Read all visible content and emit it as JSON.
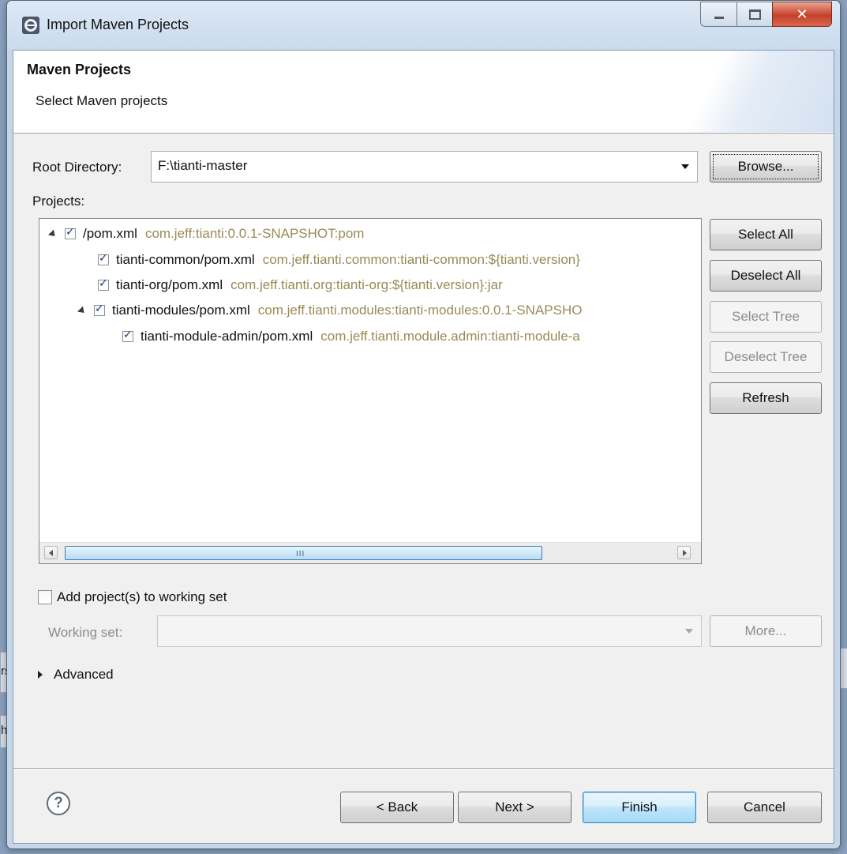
{
  "window": {
    "title": "Import Maven Projects"
  },
  "header": {
    "title": "Maven Projects",
    "subtitle": "Select Maven projects"
  },
  "root_directory": {
    "label": "Root Directory:",
    "value": "F:\\tianti-master",
    "browse": "Browse..."
  },
  "projects": {
    "label": "Projects:",
    "rows": [
      {
        "name": "/pom.xml",
        "coords": "com.jeff:tianti:0.0.1-SNAPSHOT:pom",
        "checked": true
      },
      {
        "name": "tianti-common/pom.xml",
        "coords": "com.jeff.tianti.common:tianti-common:${tianti.version}",
        "checked": true
      },
      {
        "name": "tianti-org/pom.xml",
        "coords": "com.jeff.tianti.org:tianti-org:${tianti.version}:jar",
        "checked": true
      },
      {
        "name": "tianti-modules/pom.xml",
        "coords": "com.jeff.tianti.modules:tianti-modules:0.0.1-SNAPSHO",
        "checked": true
      },
      {
        "name": "tianti-module-admin/pom.xml",
        "coords": "com.jeff.tianti.module.admin:tianti-module-a",
        "checked": true
      }
    ],
    "scroll_grip": "III"
  },
  "side_buttons": {
    "select_all": "Select All",
    "deselect_all": "Deselect All",
    "select_tree": "Select Tree",
    "deselect_tree": "Deselect Tree",
    "refresh": "Refresh"
  },
  "working_set": {
    "checkbox_label": "Add project(s) to working set",
    "label": "Working set:",
    "value": "",
    "more": "More..."
  },
  "advanced": {
    "label": "Advanced"
  },
  "footer": {
    "back": "< Back",
    "next": "Next >",
    "finish": "Finish",
    "cancel": "Cancel"
  },
  "background_fragments": {
    "left_top": "rs",
    "left_bottom": "h"
  }
}
